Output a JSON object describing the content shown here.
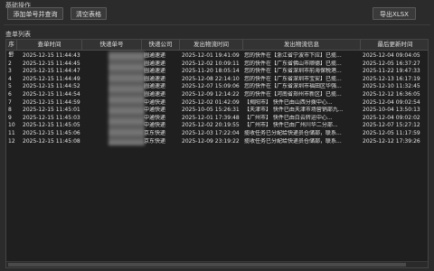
{
  "sections": {
    "ops": "基础操作",
    "list": "查单列表"
  },
  "buttons": {
    "add": "添加单号并查询",
    "clear": "清空表格",
    "export": "导出XLSX"
  },
  "columns": [
    "序号",
    "查单时间",
    "快递单号",
    "快递公司",
    "发出物流时间",
    "发出物流信息",
    "最后更新时间"
  ],
  "rows": [
    {
      "no": "1",
      "query_time": "2025-12-15 11:44:43",
      "company": "圆通速递",
      "send_time": "2025-12-01 19:41:09",
      "info": "您的快件在【浙江省宁波市下应】已揽...",
      "last_update": "2025-12-04 09:04:05"
    },
    {
      "no": "2",
      "query_time": "2025-12-15 11:44:45",
      "company": "圆通速递",
      "send_time": "2025-12-02 10:09:11",
      "info": "您的快件在【广东省佛山市顺德】已揽...",
      "last_update": "2025-12-05 16:37:27"
    },
    {
      "no": "3",
      "query_time": "2025-12-15 11:44:47",
      "company": "圆通速递",
      "send_time": "2025-11-20 18:05:14",
      "info": "您的快件在【广东省深圳市前海保税港...",
      "last_update": "2025-11-22 19:47:33"
    },
    {
      "no": "4",
      "query_time": "2025-12-15 11:44:49",
      "company": "圆通速递",
      "send_time": "2025-12-08 22:14:10",
      "info": "您的快件在【广东省深圳市宝安】已揽...",
      "last_update": "2025-12-13 16:17:19"
    },
    {
      "no": "5",
      "query_time": "2025-12-15 11:44:52",
      "company": "圆通速递",
      "send_time": "2025-12-07 15:09:06",
      "info": "您的快件在【广东省深圳市福田区华强...",
      "last_update": "2025-12-10 11:32:45"
    },
    {
      "no": "6",
      "query_time": "2025-12-15 11:44:54",
      "company": "圆通速递",
      "send_time": "2025-12-09 12:14:22",
      "info": "您的快件在【河南省郑州市新区】已揽...",
      "last_update": "2025-12-12 16:36:05"
    },
    {
      "no": "7",
      "query_time": "2025-12-15 11:44:59",
      "company": "中通快递",
      "send_time": "2025-12-02 01:42:09",
      "info": "【揭阳市】 快件已由山西分拨中心...",
      "last_update": "2025-12-04 09:02:54"
    },
    {
      "no": "8",
      "query_time": "2025-12-15 11:45:01",
      "company": "中通快递",
      "send_time": "2025-10-05 15:26:31",
      "info": "【天津市】 快件已由天津市场营销部九...",
      "last_update": "2025-10-04 13:50:13"
    },
    {
      "no": "9",
      "query_time": "2025-12-15 11:45:03",
      "company": "中通快递",
      "send_time": "2025-12-01 17:39:48",
      "info": "【广州市】 快件已由白云转运中心...",
      "last_update": "2025-12-04 09:02:02"
    },
    {
      "no": "10",
      "query_time": "2025-12-15 11:45:05",
      "company": "中通快递",
      "send_time": "2025-12-02 20:19:55",
      "info": "【广州市】 快件已由广州川华二分部...",
      "last_update": "2025-12-07 15:27:12"
    },
    {
      "no": "11",
      "query_time": "2025-12-15 11:45:06",
      "company": "京东快递",
      "send_time": "2025-12-03 17:22:04",
      "info": "揽收任务已分配给快递员仓储部，联系...",
      "last_update": "2025-12-05 11:17:59"
    },
    {
      "no": "12",
      "query_time": "2025-12-15 11:45:08",
      "company": "京东快递",
      "send_time": "2025-12-09 23:19:22",
      "info": "揽收任务已分配给快递员仓储部，联系...",
      "last_update": "2025-12-12 17:39:26"
    }
  ]
}
